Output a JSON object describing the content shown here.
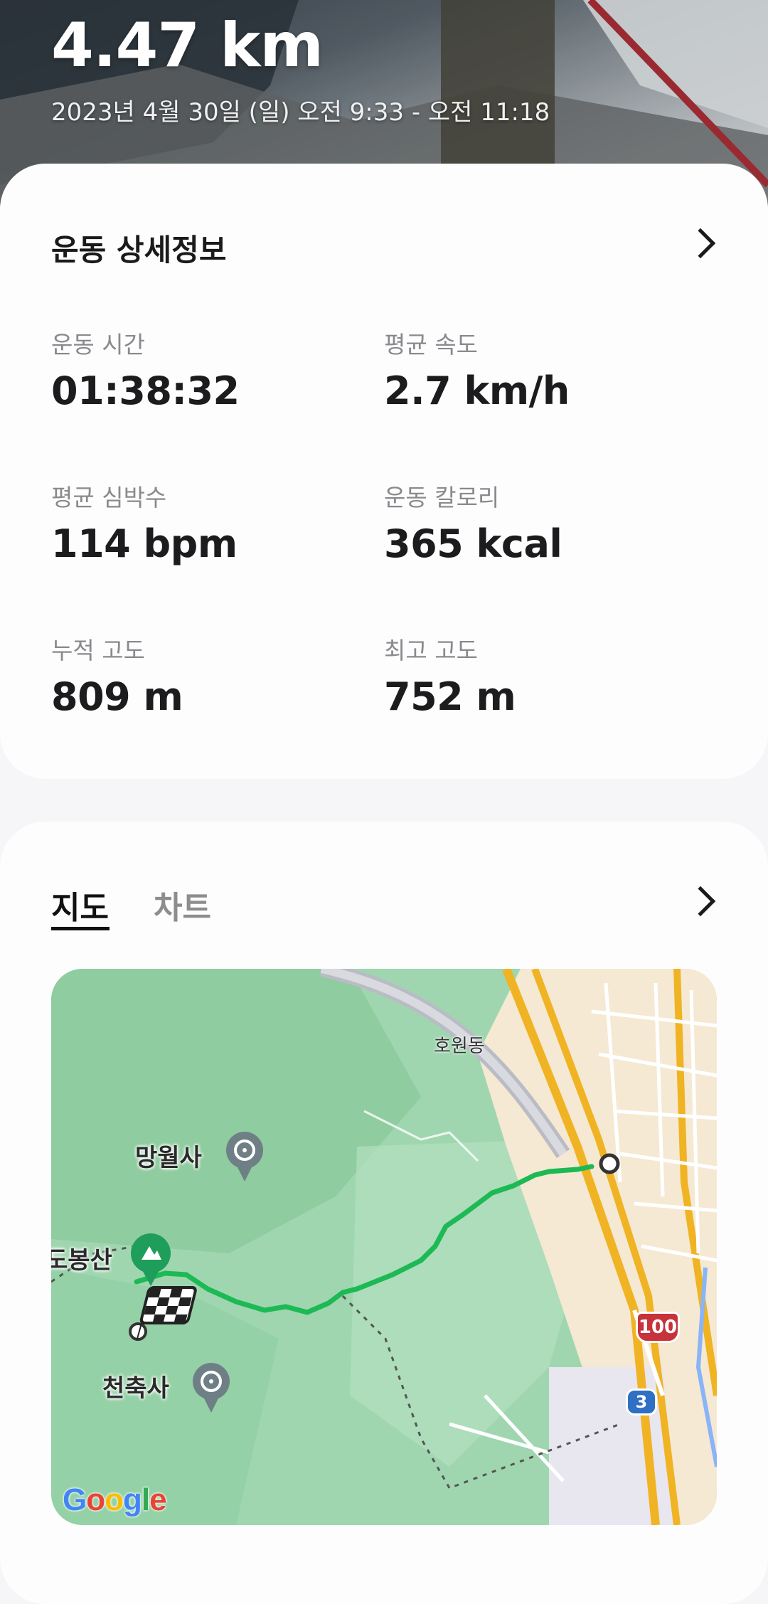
{
  "hero": {
    "distance": "4.47 km",
    "datetime": "2023년 4월 30일 (일) 오전 9:33 - 오전 11:18"
  },
  "details": {
    "title": "운동 상세정보",
    "stats": [
      {
        "label": "운동 시간",
        "value": "01:38:32"
      },
      {
        "label": "평균 속도",
        "value": "2.7 km/h"
      },
      {
        "label": "평균 심박수",
        "value": "114 bpm"
      },
      {
        "label": "운동 칼로리",
        "value": "365 kcal"
      },
      {
        "label": "누적 고도",
        "value": "809 m"
      },
      {
        "label": "최고 고도",
        "value": "752 m"
      }
    ]
  },
  "map_card": {
    "tabs": [
      {
        "label": "지도"
      },
      {
        "label": "차트"
      }
    ],
    "active_tab": "지도",
    "map": {
      "labels": {
        "hoewon": "호원동",
        "mangwolsa": "망월사",
        "dobongsan": "도봉산",
        "cheonchuksa": "천축사"
      },
      "route_shields": {
        "highway": "100",
        "national": "3"
      },
      "attribution": "Google",
      "route_color": "#1db954"
    }
  }
}
